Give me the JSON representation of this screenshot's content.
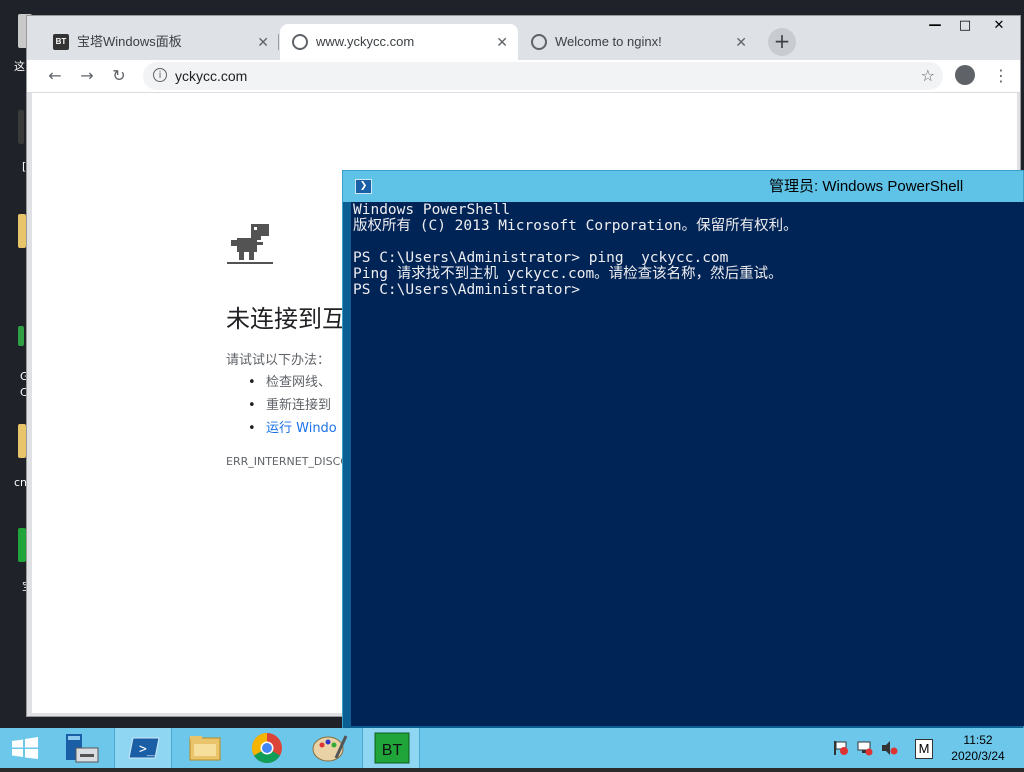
{
  "chrome": {
    "tabs": [
      {
        "label": "宝塔Windows面板",
        "favicon": "BT",
        "active": false
      },
      {
        "label": "www.yckycc.com",
        "favicon": "globe",
        "active": true
      },
      {
        "label": "Welcome to nginx!",
        "favicon": "globe",
        "active": false
      }
    ],
    "new_tab": "+",
    "window_controls": {
      "minimize": "—",
      "maximize": "□",
      "close": "✕"
    },
    "url": "yckycc.com",
    "error": {
      "title": "未连接到互",
      "try": "请试试以下办法：",
      "items": [
        "检查网线、",
        "重新连接到",
        "运行 Windo"
      ],
      "code": "ERR_INTERNET_DISCO"
    }
  },
  "powershell": {
    "title": "管理员: Windows PowerShell",
    "lines": [
      "Windows PowerShell",
      "版权所有 (C) 2013 Microsoft Corporation。保留所有权利。",
      "",
      "PS C:\\Users\\Administrator> ping  yckycc.com",
      "Ping 请求找不到主机 yckycc.com。请检查该名称，然后重试。",
      "PS C:\\Users\\Administrator>"
    ]
  },
  "desktop": {
    "labels": [
      "这",
      "[",
      "G",
      "C",
      "cnc",
      "宝"
    ]
  },
  "taskbar": {
    "items": [
      "start",
      "server-manager",
      "powershell",
      "file-explorer",
      "chrome",
      "paint",
      "bt-panel"
    ],
    "bt_label": "BT",
    "ime": "M",
    "time": "11:52",
    "date": "2020/3/24"
  },
  "colors": {
    "ps_background": "#012456",
    "ps_title": "#5fc3e8",
    "taskbar": "#6dc7ea",
    "link": "#1a73e8"
  }
}
